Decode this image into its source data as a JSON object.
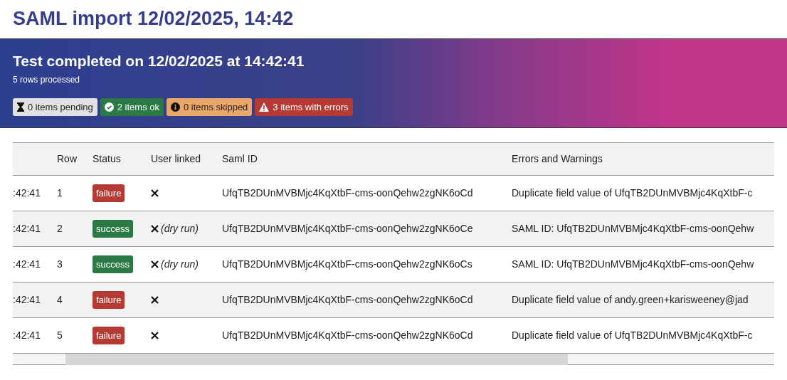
{
  "page_title": "SAML import 12/02/2025, 14:42",
  "banner": {
    "heading": "Test completed on 12/02/2025 at 14:42:41",
    "subtext": "5 rows processed",
    "counters": [
      {
        "kind": "pending",
        "label": "0 items pending"
      },
      {
        "kind": "ok",
        "label": "2 items ok"
      },
      {
        "kind": "skipped",
        "label": "0 items skipped"
      },
      {
        "kind": "error",
        "label": "3 items with errors"
      }
    ]
  },
  "table": {
    "columns": [
      "Row",
      "Status",
      "User linked",
      "Saml ID",
      "Errors and Warnings"
    ],
    "rows": [
      {
        "time": ":42:41",
        "row": "1",
        "status": {
          "kind": "failure",
          "label": "failure"
        },
        "user_linked": false,
        "saml_id": "UfqTB2DUnMVBMjc4KqXtbF-cms-oonQehw2zgNK6oCd",
        "message": "Duplicate field value of UfqTB2DUnMVBMjc4KqXtbF-c"
      },
      {
        "time": ":42:41",
        "row": "2",
        "status": {
          "kind": "success",
          "label": "success"
        },
        "user_linked": false,
        "note": "(dry run)",
        "saml_id": "UfqTB2DUnMVBMjc4KqXtbF-cms-oonQehw2zgNK6oCe",
        "message": "SAML ID: UfqTB2DUnMVBMjc4KqXtbF-cms-oonQehw"
      },
      {
        "time": ":42:41",
        "row": "3",
        "status": {
          "kind": "success",
          "label": "success"
        },
        "user_linked": false,
        "note": "(dry run)",
        "saml_id": "UfqTB2DUnMVBMjc4KqXtbF-cms-oonQehw2zgNK6oCs",
        "message": "SAML ID: UfqTB2DUnMVBMjc4KqXtbF-cms-oonQehw"
      },
      {
        "time": ":42:41",
        "row": "4",
        "status": {
          "kind": "failure",
          "label": "failure"
        },
        "user_linked": false,
        "saml_id": "UfqTB2DUnMVBMjc4KqXtbF-cms-oonQehw2zgNK6oCd",
        "message": "Duplicate field value of andy.green+karisweeney@jad"
      },
      {
        "time": ":42:41",
        "row": "5",
        "status": {
          "kind": "failure",
          "label": "failure"
        },
        "user_linked": false,
        "saml_id": "UfqTB2DUnMVBMjc4KqXtbF-cms-oonQehw2zgNK6oCd",
        "message": "Duplicate field value of UfqTB2DUnMVBMjc4KqXtbF-c"
      }
    ]
  }
}
